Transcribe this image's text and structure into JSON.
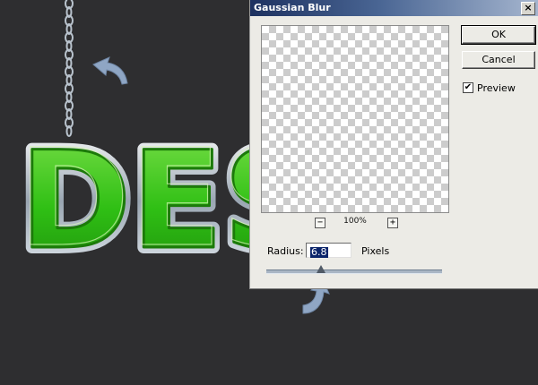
{
  "dialog": {
    "title": "Gaussian Blur",
    "close_glyph": "×",
    "ok_label": "OK",
    "cancel_label": "Cancel",
    "preview_label": "Preview",
    "preview_checked": true,
    "check_glyph": "✔",
    "zoom_level": "100%",
    "zoom_out_glyph": "−",
    "zoom_in_glyph": "+",
    "radius_label": "Radius:",
    "radius_value": "6.8",
    "units_label": "Pixels",
    "radius_slider_fraction": 0.31
  },
  "artwork": {
    "text": "DES",
    "colors": {
      "background": "#2e2e30",
      "letter_green": "#3fd020",
      "letter_light": "#c8f0a0",
      "chrome": "#c8d0d8",
      "arrow": "#8fa6c4"
    },
    "icons": [
      "chain-icon",
      "curved-arrow-icon"
    ]
  }
}
